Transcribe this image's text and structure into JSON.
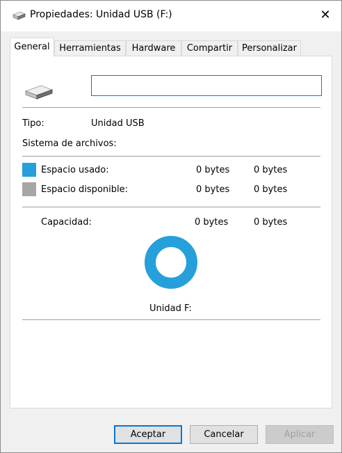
{
  "window": {
    "title": "Propiedades: Unidad USB (F:)",
    "title_icon": "usb-drive-icon",
    "close_label": "✕"
  },
  "tabs": [
    {
      "label": "General",
      "active": true
    },
    {
      "label": "Herramientas",
      "active": false
    },
    {
      "label": "Hardware",
      "active": false
    },
    {
      "label": "Compartir",
      "active": false
    },
    {
      "label": "Personalizar",
      "active": false
    }
  ],
  "general": {
    "drive_icon": "usb-drive-icon",
    "name_value": "",
    "type_label": "Tipo:",
    "type_value": "Unidad USB",
    "filesystem_label": "Sistema de archivos:",
    "filesystem_value": "",
    "used_label": "Espacio usado:",
    "used_bytes": "0 bytes",
    "used_size": "0 bytes",
    "free_label": "Espacio disponible:",
    "free_bytes": "0 bytes",
    "free_size": "0 bytes",
    "capacity_label": "Capacidad:",
    "capacity_bytes": "0 bytes",
    "capacity_size": "0 bytes",
    "drive_label": "Unidad F:"
  },
  "colors": {
    "used": "#26a0da",
    "free": "#a6a6a6",
    "focus": "#0078d7"
  },
  "buttons": {
    "ok": "Aceptar",
    "cancel": "Cancelar",
    "apply": "Aplicar"
  }
}
